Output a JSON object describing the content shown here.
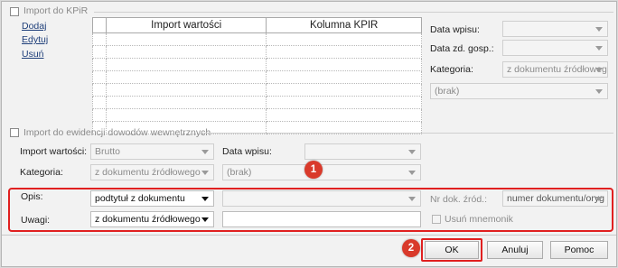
{
  "kpir": {
    "group_label": "Import do KPiR",
    "links": {
      "add": "Dodaj",
      "edit": "Edytuj",
      "delete": "Usuń"
    },
    "columns": [
      "Import wartości",
      "Kolumna KPIR"
    ],
    "fields": {
      "data_wpisu_label": "Data wpisu:",
      "data_wpisu_value": "",
      "data_zd_gosp_label": "Data zd. gosp.:",
      "data_zd_gosp_value": "",
      "kategoria_label": "Kategoria:",
      "kategoria_value": "z dokumentu źródłowego",
      "brak_value": "(brak)"
    }
  },
  "internal": {
    "group_label": "Import do ewidencji dowodów wewnętrznych",
    "import_label": "Import wartości:",
    "import_value": "Brutto",
    "data_wpisu_label": "Data wpisu:",
    "data_wpisu_value": "",
    "kategoria_label": "Kategoria:",
    "kategoria_value": "z dokumentu źródłowego",
    "brak_value": "(brak)"
  },
  "opis_section": {
    "opis_label": "Opis:",
    "opis_value": "podtytuł z dokumentu",
    "opis_extra_value": "",
    "nr_dok_label": "Nr dok. źród.:",
    "nr_dok_value": "numer dokumentu/oryg",
    "uwagi_label": "Uwagi:",
    "uwagi_value": "z dokumentu źródłowego",
    "uwagi_text": "",
    "usun_mnemonik_label": "Usuń mnemonik"
  },
  "badges": {
    "first": "1",
    "second": "2"
  },
  "buttons": {
    "ok": "OK",
    "cancel": "Anuluj",
    "help": "Pomoc"
  },
  "colors": {
    "highlight_border": "#e02020",
    "badge": "#d93a2b"
  }
}
